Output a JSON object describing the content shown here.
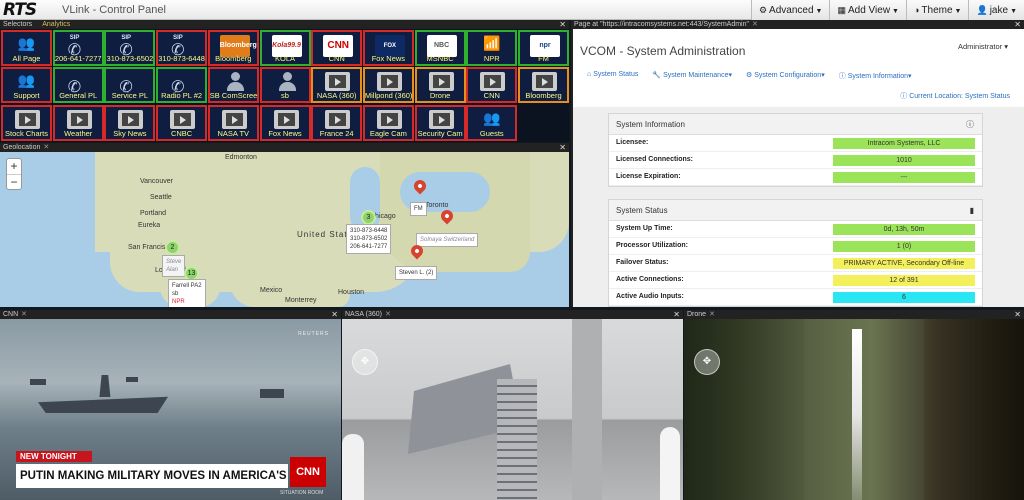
{
  "app": {
    "logo": "RTS",
    "title": "VLink - Control Panel",
    "menu": [
      {
        "label": "Advanced",
        "icon": "gear-icon"
      },
      {
        "label": "Add View",
        "icon": "grid-icon"
      },
      {
        "label": "Theme",
        "icon": "contrast-icon"
      },
      {
        "label": "jake",
        "icon": "user-icon"
      }
    ]
  },
  "selectors_panel": {
    "tabs": [
      "Selectors",
      "Analytics"
    ],
    "tiles": [
      {
        "label": "All Page",
        "icon": "group-lock-icon"
      },
      {
        "label": "206-641-7277",
        "icon": "sip-phone-icon"
      },
      {
        "label": "310-873-6502",
        "icon": "sip-phone-icon"
      },
      {
        "label": "310-873-6448",
        "icon": "sip-phone-icon"
      },
      {
        "label": "Bloomberg",
        "icon": "bloomberg-logo",
        "logo_text": "Bloomberg"
      },
      {
        "label": "KOLA",
        "icon": "kola-logo",
        "logo_text": "Kola99.9"
      },
      {
        "label": "CNN",
        "icon": "cnn-logo",
        "logo_text": "CNN"
      },
      {
        "label": "Fox News",
        "icon": "fox-news-logo",
        "logo_text": "FOX NEWS"
      },
      {
        "label": "MSNBC",
        "icon": "nbc-logo",
        "logo_text": "NBC"
      },
      {
        "label": "NPR",
        "icon": "router-icon"
      },
      {
        "label": "FM",
        "icon": "npr-logo",
        "logo_text": "npr"
      },
      {
        "label": "Support",
        "icon": "group-lock-icon"
      },
      {
        "label": "General PL",
        "icon": "handset-icon"
      },
      {
        "label": "Service PL",
        "icon": "handset-icon"
      },
      {
        "label": "Radio PL #2",
        "icon": "handset-icon"
      },
      {
        "label": "SB ComScreen",
        "icon": "person-icon"
      },
      {
        "label": "sb",
        "icon": "person-icon"
      },
      {
        "label": "NASA (360)",
        "icon": "video-icon"
      },
      {
        "label": "Millpond (360)",
        "icon": "video-icon"
      },
      {
        "label": "Drone",
        "icon": "video-icon"
      },
      {
        "label": "CNN",
        "icon": "video-icon"
      },
      {
        "label": "Bloomberg",
        "icon": "video-icon"
      },
      {
        "label": "Stock Charts",
        "icon": "video-icon"
      },
      {
        "label": "Weather",
        "icon": "video-icon"
      },
      {
        "label": "Sky News",
        "icon": "video-icon"
      },
      {
        "label": "CNBC",
        "icon": "video-icon"
      },
      {
        "label": "NASA TV",
        "icon": "video-icon"
      },
      {
        "label": "Fox News",
        "icon": "video-icon"
      },
      {
        "label": "France 24",
        "icon": "video-icon"
      },
      {
        "label": "Eagle Cam",
        "icon": "video-icon"
      },
      {
        "label": "Security Cam",
        "icon": "video-icon"
      },
      {
        "label": "Guests",
        "icon": "group-lock-icon"
      }
    ]
  },
  "geolocation": {
    "tab": "Geolocation",
    "zoom_in": "+",
    "zoom_out": "−",
    "labels": [
      "Edmonton",
      "Vancouver",
      "Seattle",
      "Portland",
      "Eureka",
      "San Francisco",
      "Los Angeles",
      "United States",
      "Chicago",
      "Houston",
      "Monterrey",
      "Mexico",
      "Toronto"
    ],
    "clusters": [
      "3",
      "2",
      "13"
    ],
    "popups": {
      "cluster3": [
        "310-873-6448",
        "310-873-6502",
        "206-641-7277"
      ],
      "sf": [
        "Steve",
        "Alan"
      ],
      "la": [
        "Farrell PA2",
        "sb",
        "NPR"
      ],
      "toronto": "FM",
      "northeast": "Solnaya Switzerland",
      "southeast": "Steven L. (2)"
    }
  },
  "admin": {
    "tab": "Page at \"https://intracomsystems.net:443/SystemAdmin\"",
    "title": "VCOM - System Administration",
    "user": "Administrator",
    "nav": [
      "System Status",
      "System Maintenance",
      "System Configuration",
      "System Information"
    ],
    "location": "Current Location: System Status",
    "info": {
      "heading": "System Information",
      "rows": [
        {
          "key": "Licensee:",
          "value": "Intracom Systems, LLC"
        },
        {
          "key": "Licensed Connections:",
          "value": "1010"
        },
        {
          "key": "License Expiration:",
          "value": "---"
        }
      ]
    },
    "status": {
      "heading": "System Status",
      "rows": [
        {
          "key": "System Up Time:",
          "value": "0d, 13h, 50m"
        },
        {
          "key": "Processor Utilization:",
          "value": "1 (0)"
        },
        {
          "key": "Failover Status:",
          "value": "PRIMARY ACTIVE, Secondary Off-line"
        },
        {
          "key": "Active Connections:",
          "value": "12 of 391"
        },
        {
          "key": "Active Audio Inputs:",
          "value": "6"
        }
      ]
    },
    "colors": {
      "green": "#9be45a",
      "yellow": "#f3f05c",
      "cyan": "#29e6f2"
    }
  },
  "videos": {
    "cnn": {
      "tab": "CNN",
      "kicker": "NEW TONIGHT",
      "headline": "PUTIN MAKING MILITARY MOVES IN AMERICA'S BACKYARD",
      "bug": "CNN",
      "show": "SITUATION ROOM",
      "watermark": "REUTERS"
    },
    "nasa": {
      "tab": "NASA (360)"
    },
    "drone": {
      "tab": "Drone"
    }
  }
}
